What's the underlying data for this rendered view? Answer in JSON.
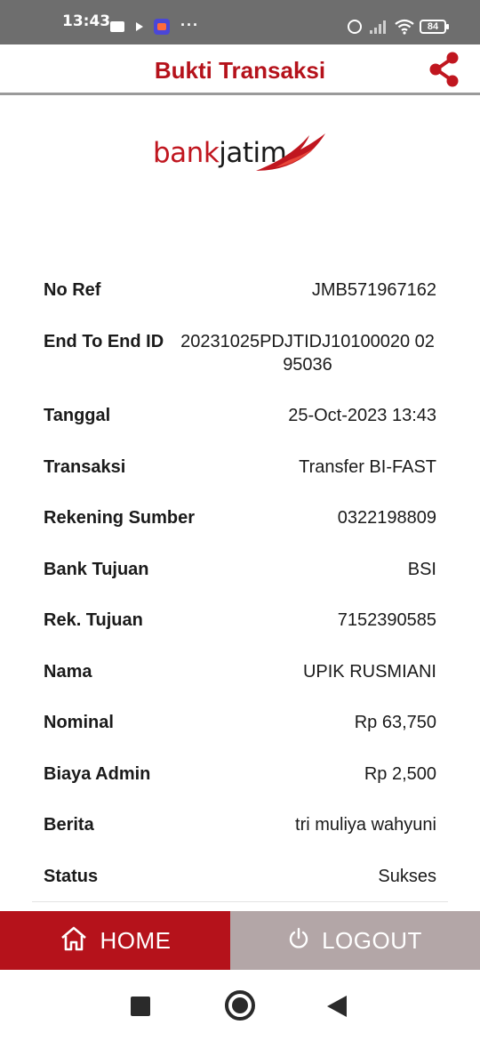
{
  "status_bar": {
    "time": "13:43",
    "battery": "84"
  },
  "header": {
    "title": "Bukti Transaksi"
  },
  "logo": {
    "bank": "bank",
    "jatim": "jatim"
  },
  "details": [
    {
      "label": "No Ref",
      "value": "JMB571967162"
    },
    {
      "label": "End To End ID",
      "value": "20231025PDJTIDJ10100020 0295036"
    },
    {
      "label": "Tanggal",
      "value": "25-Oct-2023 13:43"
    },
    {
      "label": "Transaksi",
      "value": "Transfer BI-FAST"
    },
    {
      "label": "Rekening Sumber",
      "value": "0322198809"
    },
    {
      "label": "Bank Tujuan",
      "value": "BSI"
    },
    {
      "label": "Rek. Tujuan",
      "value": "7152390585"
    },
    {
      "label": "Nama",
      "value": "UPIK RUSMIANI"
    },
    {
      "label": "Nominal",
      "value": "Rp 63,750"
    },
    {
      "label": "Biaya Admin",
      "value": "Rp 2,500"
    },
    {
      "label": "Berita",
      "value": "tri muliya wahyuni"
    },
    {
      "label": "Status",
      "value": "Sukses"
    }
  ],
  "buttons": {
    "home": "HOME",
    "logout": "LOGOUT"
  },
  "colors": {
    "brand_red": "#b5121b",
    "logout_bg": "#b3a6a7",
    "status_bar": "#6e6e6e"
  }
}
